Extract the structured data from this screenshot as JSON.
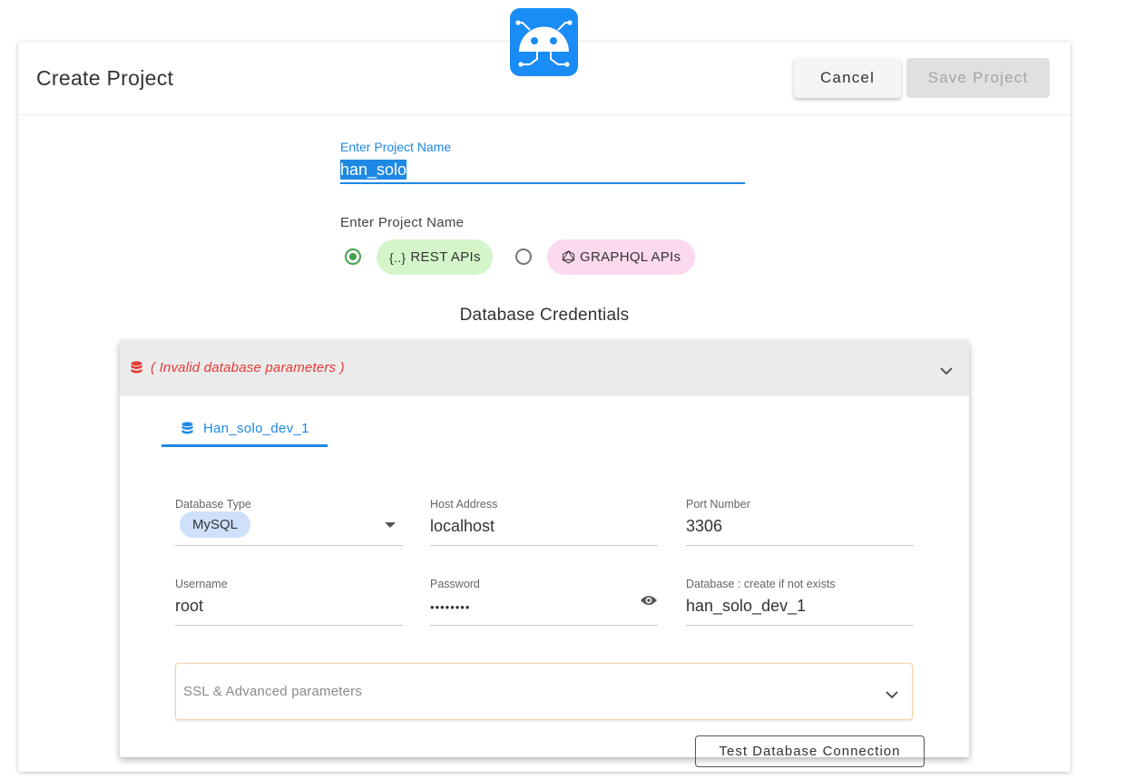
{
  "header": {
    "title": "Create Project",
    "cancel_label": "Cancel",
    "save_label": "Save Project"
  },
  "project": {
    "name_label": "Enter Project Name",
    "name_value": "han_solo",
    "type_label": "Enter Project Name",
    "types": [
      {
        "label": "REST APIs",
        "icon": "braces-icon",
        "selected": true,
        "color": "#d4f5c9"
      },
      {
        "label": "GRAPHQL APIs",
        "icon": "graphql-icon",
        "selected": false,
        "color": "#fcd9ee"
      }
    ]
  },
  "db_section": {
    "title": "Database Credentials",
    "error": "( Invalid database parameters )",
    "tab_label": "Han_solo_dev_1",
    "fields": {
      "db_type": {
        "label": "Database Type",
        "value": "MySQL"
      },
      "host": {
        "label": "Host Address",
        "value": "localhost"
      },
      "port": {
        "label": "Port Number",
        "value": "3306"
      },
      "username": {
        "label": "Username",
        "value": "root"
      },
      "password": {
        "label": "Password",
        "value": "••••••••"
      },
      "database": {
        "label": "Database : create if not exists",
        "value": "han_solo_dev_1"
      }
    },
    "ssl_label": "SSL & Advanced parameters",
    "test_label": "Test Database Connection"
  },
  "colors": {
    "accent": "#1e88e5",
    "error": "#e53935",
    "success": "#43a047",
    "logo_bg": "#1a8cf5"
  }
}
